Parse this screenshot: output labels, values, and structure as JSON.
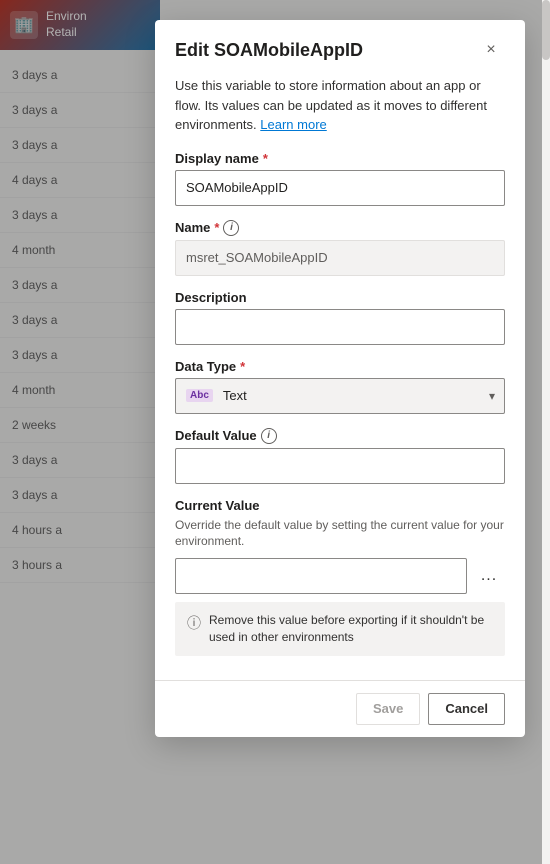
{
  "app": {
    "title": "Environ Retail"
  },
  "background": {
    "header": {
      "icon": "🏢",
      "line1": "Environ",
      "line2": "Retail"
    },
    "list_items": [
      {
        "time": "3 days a"
      },
      {
        "time": "3 days a"
      },
      {
        "time": "3 days a"
      },
      {
        "time": "4 days a"
      },
      {
        "time": "3 days a"
      },
      {
        "time": "4 month"
      },
      {
        "time": "3 days a"
      },
      {
        "time": "3 days a"
      },
      {
        "time": "3 days a"
      },
      {
        "time": "4 month"
      },
      {
        "time": "2 weeks"
      },
      {
        "time": "3 days a"
      },
      {
        "time": "3 days a"
      },
      {
        "time": "4 hours a"
      },
      {
        "time": "3 hours a"
      }
    ]
  },
  "modal": {
    "title": "Edit SOAMobileAppID",
    "close_label": "×",
    "description": "Use this variable to store information about an app or flow. Its values can be updated as it moves to different environments.",
    "learn_more_label": "Learn more",
    "fields": {
      "display_name": {
        "label": "Display name",
        "required": true,
        "value": "SOAMobileAppID",
        "placeholder": ""
      },
      "name": {
        "label": "Name",
        "required": true,
        "info": true,
        "value": "msret_SOAMobileAppID",
        "readonly": true
      },
      "description": {
        "label": "Description",
        "required": false,
        "value": "",
        "placeholder": ""
      },
      "data_type": {
        "label": "Data Type",
        "required": true,
        "value": "Text",
        "type_badge": "Abc"
      },
      "default_value": {
        "label": "Default Value",
        "info": true,
        "value": "",
        "placeholder": ""
      },
      "current_value": {
        "label": "Current Value",
        "description": "Override the default value by setting the current value for your environment.",
        "value": "",
        "placeholder": "",
        "ellipsis": "..."
      }
    },
    "info_box": {
      "text": "Remove this value before exporting if it shouldn't be used in other environments"
    },
    "footer": {
      "save_label": "Save",
      "cancel_label": "Cancel"
    }
  }
}
